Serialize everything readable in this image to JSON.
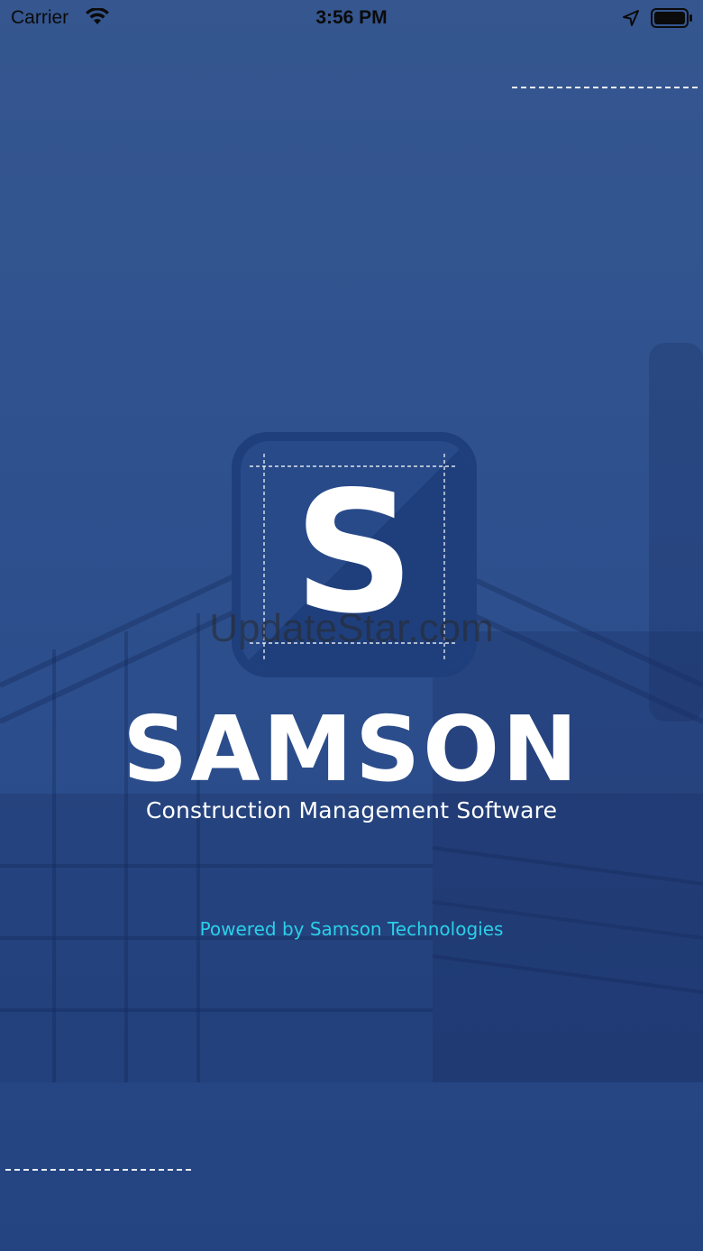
{
  "status_bar": {
    "carrier": "Carrier",
    "time": "3:56 PM",
    "icons": [
      "wifi-icon",
      "location-icon",
      "battery-icon"
    ]
  },
  "logo": {
    "letter": "S",
    "icon": "samson-logo-icon"
  },
  "watermark": "UpdateStar.com",
  "brand": {
    "name": "SAMSON",
    "tagline": "Construction Management Software"
  },
  "footer": {
    "powered_by": "Powered by Samson Technologies"
  },
  "colors": {
    "background": "#2f528f",
    "logo_tile": "#21427f",
    "accent_text": "#2ad0e8",
    "text": "#ffffff"
  }
}
